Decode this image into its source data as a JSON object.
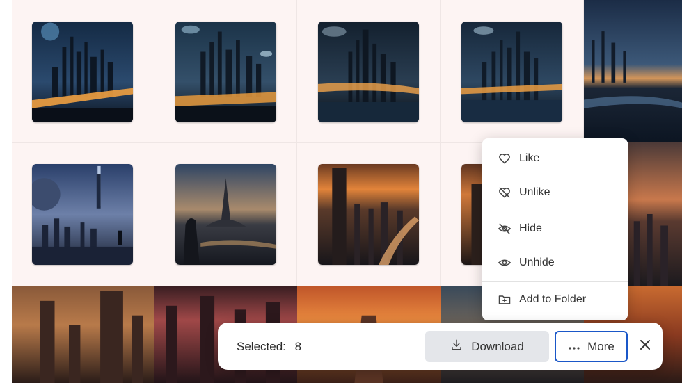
{
  "selection_bar": {
    "selected_label": "Selected:",
    "selected_count": "8",
    "download_label": "Download",
    "more_label": "More",
    "download_icon": "download-icon",
    "more_icon": "ellipsis-icon",
    "close_icon": "close-icon"
  },
  "more_menu": {
    "items": [
      {
        "label": "Like",
        "icon": "heart-icon"
      },
      {
        "label": "Unlike",
        "icon": "heart-slash-icon"
      },
      {
        "label": "Hide",
        "icon": "eye-slash-icon"
      },
      {
        "label": "Unhide",
        "icon": "eye-icon"
      },
      {
        "label": "Add to Folder",
        "icon": "folder-plus-icon"
      }
    ]
  },
  "gallery": {
    "selected_count": 8,
    "tiles": [
      {
        "theme": "futuristic city night",
        "selected": true
      },
      {
        "theme": "futuristic city night",
        "selected": true
      },
      {
        "theme": "futuristic city night",
        "selected": true
      },
      {
        "theme": "futuristic city night",
        "selected": true
      },
      {
        "theme": "city river dusk",
        "selected": false
      },
      {
        "theme": "city planet blue",
        "selected": true
      },
      {
        "theme": "citadel with figure",
        "selected": true
      },
      {
        "theme": "tower sunset aerial",
        "selected": true
      },
      {
        "theme": "tower sunset aerial",
        "selected": true
      },
      {
        "theme": "city sunset skyline",
        "selected": false
      },
      {
        "theme": "red city towers",
        "selected": false
      },
      {
        "theme": "red city towers",
        "selected": false
      },
      {
        "theme": "orange sky city",
        "selected": false
      },
      {
        "theme": "city towers dusk",
        "selected": false
      },
      {
        "theme": "orange sky city",
        "selected": false
      }
    ]
  },
  "colors": {
    "accent": "#1a57c8",
    "selected_tile_bg": "#fdf4f3",
    "download_bg": "#e4e6ea"
  }
}
